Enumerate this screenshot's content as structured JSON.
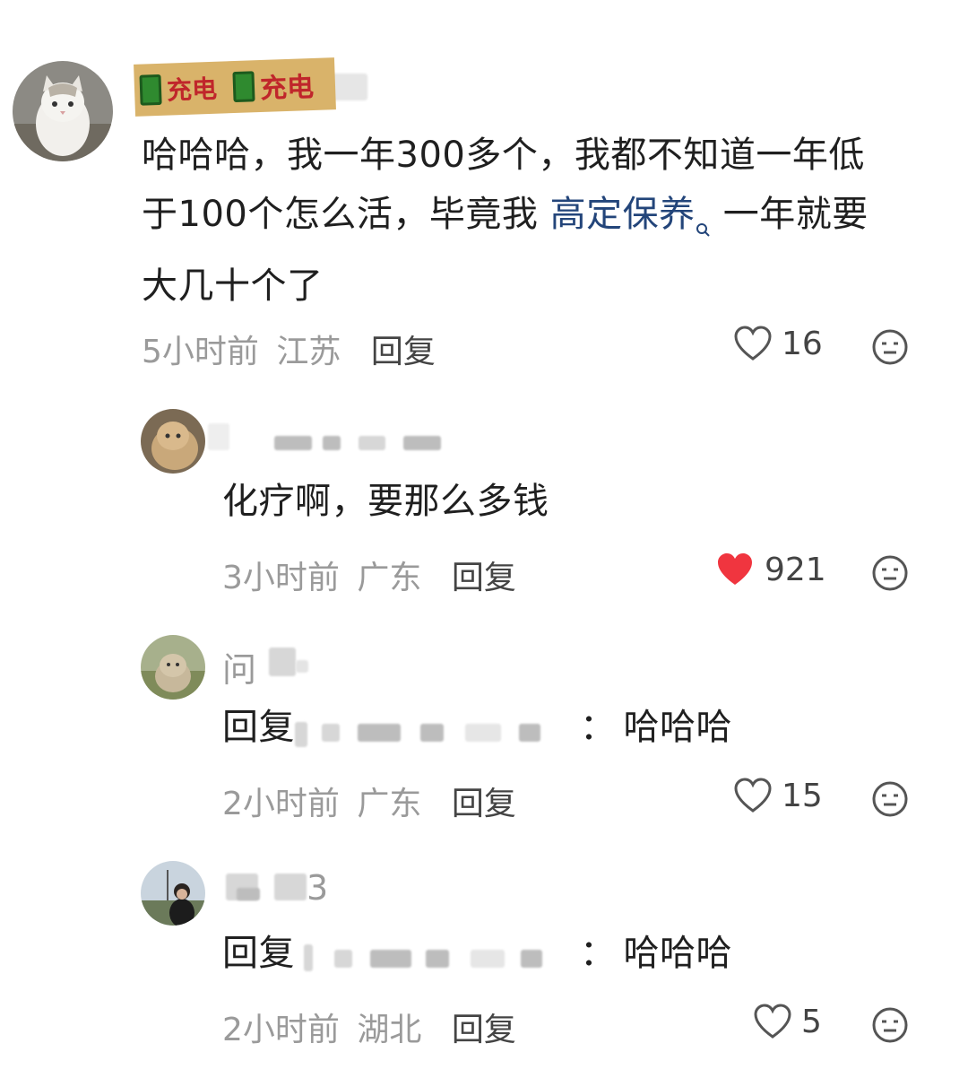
{
  "badge": {
    "text1": "充电",
    "text2": "充电"
  },
  "comments": [
    {
      "avatar": "white-cat-avatar",
      "text_lines": [
        "哈哈哈，我一年300多个，我都不知道一年低",
        "于100个怎么活，毕竟我",
        "一年就要",
        "大几十个了"
      ],
      "link_text": "高定保养",
      "time": "5小时前",
      "location": "江苏",
      "reply_label": "回复",
      "likes": "16",
      "liked": false
    },
    {
      "avatar": "orange-cat-avatar",
      "text": "化疗啊，要那么多钱",
      "time": "3小时前",
      "location": "广东",
      "reply_label": "回复",
      "likes": "921",
      "liked": true
    },
    {
      "avatar": "cat-in-grass-avatar",
      "username": "问",
      "reply_prefix": "回复",
      "colon": "：",
      "text": "哈哈哈",
      "time": "2小时前",
      "location": "广东",
      "reply_label": "回复",
      "likes": "15",
      "liked": false
    },
    {
      "avatar": "person-photo-avatar",
      "username": "3",
      "reply_prefix": "回复",
      "colon": "：",
      "text": "哈哈哈",
      "time": "2小时前",
      "location": "湖北",
      "reply_label": "回复",
      "likes": "5",
      "liked": false
    }
  ],
  "colors": {
    "like_red": "#f0353f",
    "link_blue": "#23457a",
    "meta_gray": "#9a9a9a"
  },
  "icons": {
    "like": "heart-icon",
    "liked": "heart-filled-icon",
    "react": "neutral-face-icon",
    "search": "search-icon"
  }
}
